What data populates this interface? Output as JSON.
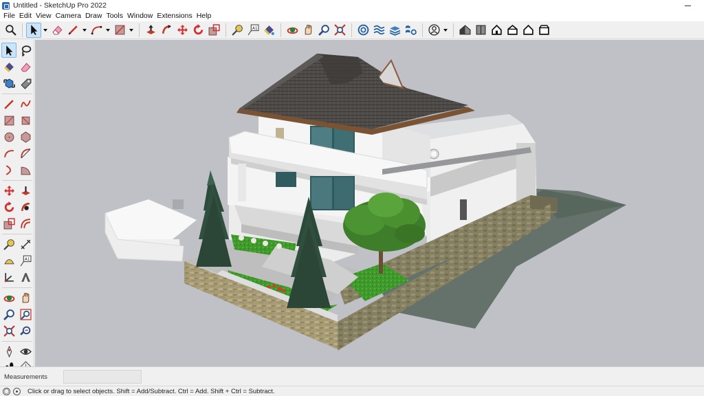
{
  "window": {
    "title": "Untitled - SketchUp Pro 2022"
  },
  "menu": [
    "File",
    "Edit",
    "View",
    "Camera",
    "Draw",
    "Tools",
    "Window",
    "Extensions",
    "Help"
  ],
  "toolbar_icons": [
    "search-icon",
    "select-icon",
    "eraser-icon",
    "pencil-icon",
    "arc-icon",
    "rectangle-icon",
    "push-pull-icon",
    "follow-me-icon",
    "move-icon",
    "rotate-icon",
    "scale-icon",
    "tape-measure-icon",
    "text-icon",
    "paint-bucket-icon",
    "orbit-icon",
    "pan-icon",
    "zoom-icon",
    "zoom-extents-icon",
    "warehouse-icon",
    "extension-warehouse-icon",
    "layout-icon",
    "extension-manager-icon",
    "account-icon",
    "iso-view-icon",
    "top-view-icon",
    "front-view-icon",
    "right-view-icon",
    "back-view-icon",
    "left-view-icon"
  ],
  "measurements": {
    "label": "Measurements",
    "value": ""
  },
  "status": {
    "hint": "Click or drag to select objects. Shift = Add/Subtract. Ctrl = Add. Shift + Ctrl = Subtract."
  },
  "colors": {
    "viewport": "#c0c1c6",
    "roof": "#4d4a48",
    "wall": "#f2f2f2",
    "stone": "#a89c77",
    "grass": "#3e9a2a",
    "tree": "#2f4a3b",
    "selected": "#cce4f7"
  }
}
